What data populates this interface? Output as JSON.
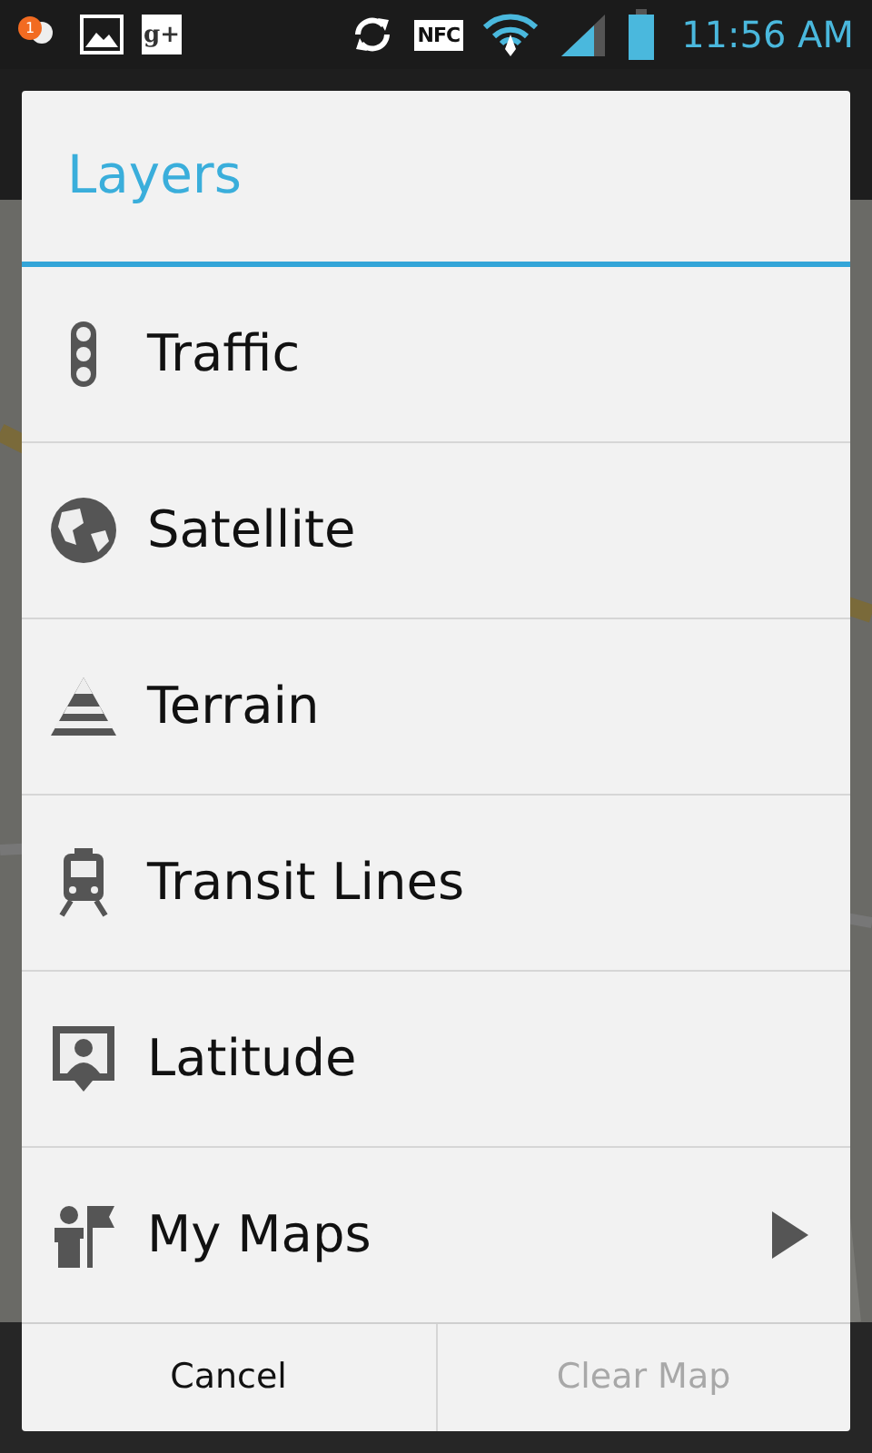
{
  "status_bar": {
    "notification_count": "1",
    "nfc_label": "NFC",
    "gplus_label": "g+",
    "time": "11:56 AM"
  },
  "dialog": {
    "title": "Layers",
    "items": [
      {
        "kind": "traffic",
        "label": "Traffic",
        "has_submenu": false
      },
      {
        "kind": "satellite",
        "label": "Satellite",
        "has_submenu": false
      },
      {
        "kind": "terrain",
        "label": "Terrain",
        "has_submenu": false
      },
      {
        "kind": "transit",
        "label": "Transit Lines",
        "has_submenu": false
      },
      {
        "kind": "latitude",
        "label": "Latitude",
        "has_submenu": false
      },
      {
        "kind": "mymaps",
        "label": "My Maps",
        "has_submenu": true
      }
    ],
    "buttons": [
      {
        "label": "Cancel",
        "disabled": false
      },
      {
        "label": "Clear Map",
        "disabled": true
      }
    ]
  }
}
